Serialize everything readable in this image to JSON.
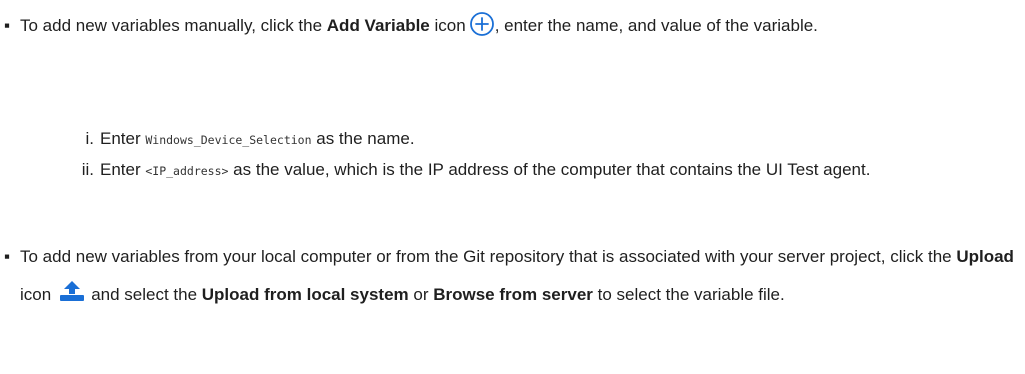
{
  "bullet_marker": "▪",
  "item1": {
    "t1": "To add new variables manually, click the ",
    "b1": "Add Variable",
    "t2": " icon",
    "t3": ", enter the name, and value of the variable.",
    "icon": "add-circle-icon"
  },
  "sub1": {
    "marker": "i.",
    "t1": "Enter ",
    "code": "Windows_Device_Selection",
    "t2": " as the name."
  },
  "sub2": {
    "marker": "ii.",
    "t1": "Enter ",
    "code": "<IP_address>",
    "t2": " as the value, which is the IP address of the computer that contains the UI Test agent."
  },
  "item2": {
    "t1": "To add new variables from your local computer or from the Git repository that is associated with your server project, click the ",
    "b1": "Upload",
    "t2": " icon",
    "t3": "and select the ",
    "b2": "Upload from local system",
    "t4": " or ",
    "b3": "Browse from server",
    "t5": " to select the variable file.",
    "icon": "upload-icon"
  },
  "colors": {
    "text": "#1f1f1f",
    "icon_blue": "#1a6fd6"
  }
}
